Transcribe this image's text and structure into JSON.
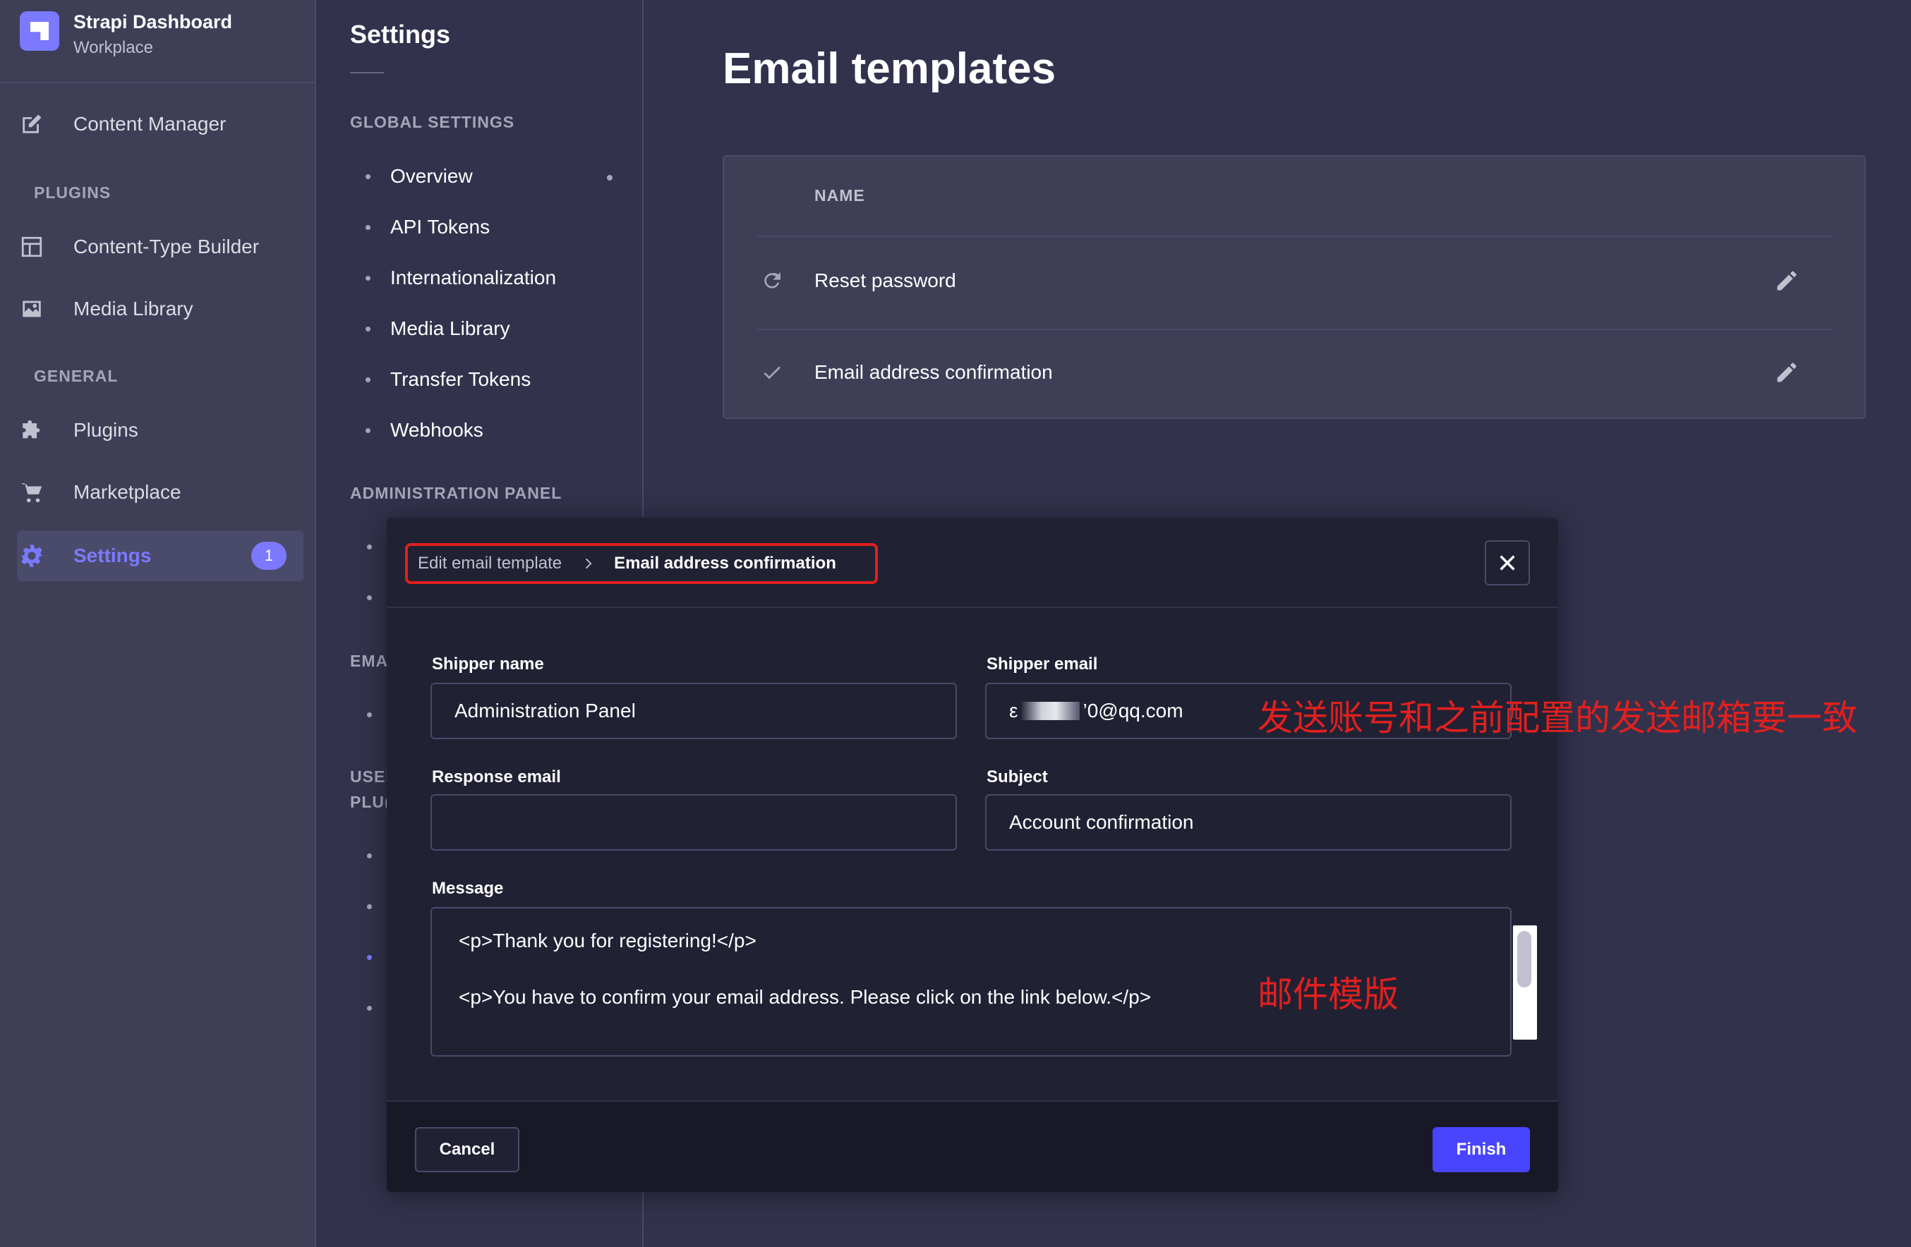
{
  "brand": {
    "title": "Strapi Dashboard",
    "subtitle": "Workplace"
  },
  "mainnav": {
    "content_manager": "Content Manager",
    "plugins_section": "PLUGINS",
    "content_type_builder": "Content-Type Builder",
    "media_library": "Media Library",
    "general_section": "GENERAL",
    "plugins": "Plugins",
    "marketplace": "Marketplace",
    "settings": "Settings",
    "settings_badge": "1"
  },
  "subnav": {
    "title": "Settings",
    "global_section": "GLOBAL SETTINGS",
    "global_items": [
      "Overview",
      "API Tokens",
      "Internationalization",
      "Media Library",
      "Transfer Tokens",
      "Webhooks"
    ],
    "admin_section": "ADMINISTRATION PANEL",
    "email_section_partial": "EMA",
    "users_section_partial_1": "USEI",
    "users_section_partial_2": "PLU("
  },
  "main": {
    "title": "Email templates",
    "table_header": "NAME",
    "rows": [
      {
        "name": "Reset password",
        "icon": "refresh-icon"
      },
      {
        "name": "Email address confirmation",
        "icon": "check-icon"
      }
    ]
  },
  "modal": {
    "breadcrumb_parent": "Edit email template",
    "breadcrumb_current": "Email address confirmation",
    "shipper_name_label": "Shipper name",
    "shipper_name_value": "Administration Panel",
    "shipper_email_label": "Shipper email",
    "shipper_email_prefix": "ε",
    "shipper_email_suffix": "’0@qq.com",
    "response_email_label": "Response email",
    "response_email_value": "",
    "subject_label": "Subject",
    "subject_value": "Account confirmation",
    "message_label": "Message",
    "message_line_1": "<p>Thank you for registering!</p>",
    "message_line_2": "<p>You have to confirm your email address. Please click on the link below.</p>",
    "cancel_label": "Cancel",
    "finish_label": "Finish"
  },
  "annotations": {
    "sender_note": "发送账号和之前配置的发送邮箱要一致",
    "template_note": "邮件模版"
  },
  "colors": {
    "accent": "#7b79ff",
    "primary_button": "#4945ff",
    "annotation_red": "#e0201e",
    "background": "#32324d"
  }
}
